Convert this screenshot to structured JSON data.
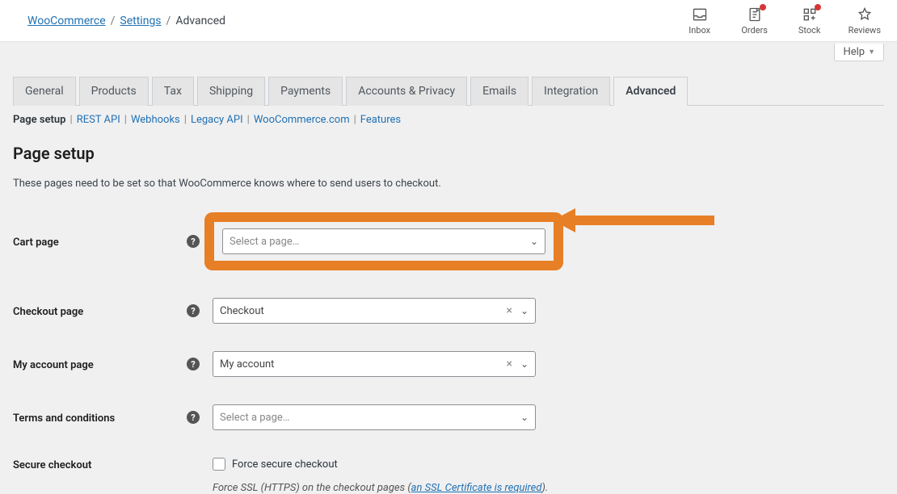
{
  "breadcrumbs": {
    "woocommerce": "WooCommerce",
    "settings": "Settings",
    "current": "Advanced"
  },
  "top_icons": {
    "inbox": "Inbox",
    "orders": "Orders",
    "stock": "Stock",
    "reviews": "Reviews"
  },
  "help_tab": "Help",
  "tabs": [
    {
      "label": "General"
    },
    {
      "label": "Products"
    },
    {
      "label": "Tax"
    },
    {
      "label": "Shipping"
    },
    {
      "label": "Payments"
    },
    {
      "label": "Accounts & Privacy"
    },
    {
      "label": "Emails"
    },
    {
      "label": "Integration"
    },
    {
      "label": "Advanced"
    }
  ],
  "subnav": {
    "current": "Page setup",
    "links": [
      "REST API",
      "Webhooks",
      "Legacy API",
      "WooCommerce.com",
      "Features"
    ]
  },
  "section": {
    "title": "Page setup",
    "desc": "These pages need to be set so that WooCommerce knows where to send users to checkout."
  },
  "fields": {
    "cart_page": {
      "label": "Cart page",
      "placeholder": "Select a page…"
    },
    "checkout_page": {
      "label": "Checkout page",
      "value": "Checkout"
    },
    "my_account_page": {
      "label": "My account page",
      "value": "My account"
    },
    "terms_page": {
      "label": "Terms and conditions",
      "placeholder": "Select a page…"
    },
    "secure_checkout": {
      "label": "Secure checkout",
      "checkbox_label": "Force secure checkout",
      "hint_prefix": "Force SSL (HTTPS) on the checkout pages (",
      "hint_link": "an SSL Certificate is required",
      "hint_suffix": ")."
    }
  }
}
